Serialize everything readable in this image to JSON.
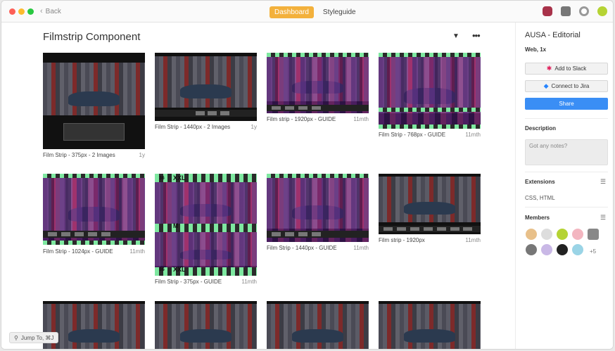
{
  "titlebar": {
    "back_label": "Back",
    "tabs": [
      {
        "label": "Dashboard",
        "active": true
      },
      {
        "label": "Styleguide",
        "active": false
      }
    ],
    "icons": [
      "mascot-icon",
      "chat-icon",
      "help-lifebuoy-icon",
      "tennis-ball-icon"
    ]
  },
  "main": {
    "title": "Filmstrip Component",
    "cards": [
      {
        "caption": "Film Strip - 375px  - 2 Images",
        "age": "1y",
        "style": "dark"
      },
      {
        "caption": "Film Strip - 1440px  - 2 Images",
        "age": "1y",
        "style": "dark"
      },
      {
        "caption": "Film strip - 1920px - GUIDE",
        "age": "11mth",
        "style": "purple"
      },
      {
        "caption": "Film Strip - 768px - GUIDE",
        "age": "11mth",
        "style": "purple"
      },
      {
        "caption": "Film Strip - 1024px - GUIDE",
        "age": "11mth",
        "style": "purple"
      },
      {
        "caption": "Film Strip - 375px - GUIDE",
        "age": "11mth",
        "style": "purple"
      },
      {
        "caption": "Film Strip - 1440px - GUIDE",
        "age": "11mth",
        "style": "purple"
      },
      {
        "caption": "Film strip - 1920px",
        "age": "11mth",
        "style": "dark"
      }
    ],
    "guide_labels": {
      "xxl": "XXL",
      "m": "M",
      "num": "36"
    },
    "jump_label": "Jump To, ⌘J"
  },
  "sidebar": {
    "title": "AUSA - Editorial",
    "subtitle": "Web, 1x",
    "add_slack": "Add to Slack",
    "connect_jira": "Connect to Jira",
    "share": "Share",
    "description_label": "Description",
    "notes_placeholder": "Got any notes?",
    "extensions_label": "Extensions",
    "extensions_value": "CSS, HTML",
    "members_label": "Members",
    "members_more": "+5"
  },
  "colors": {
    "accent": "#f3b13c",
    "primary_button": "#3a8ef5",
    "neon_green": "#7ee8a0"
  }
}
